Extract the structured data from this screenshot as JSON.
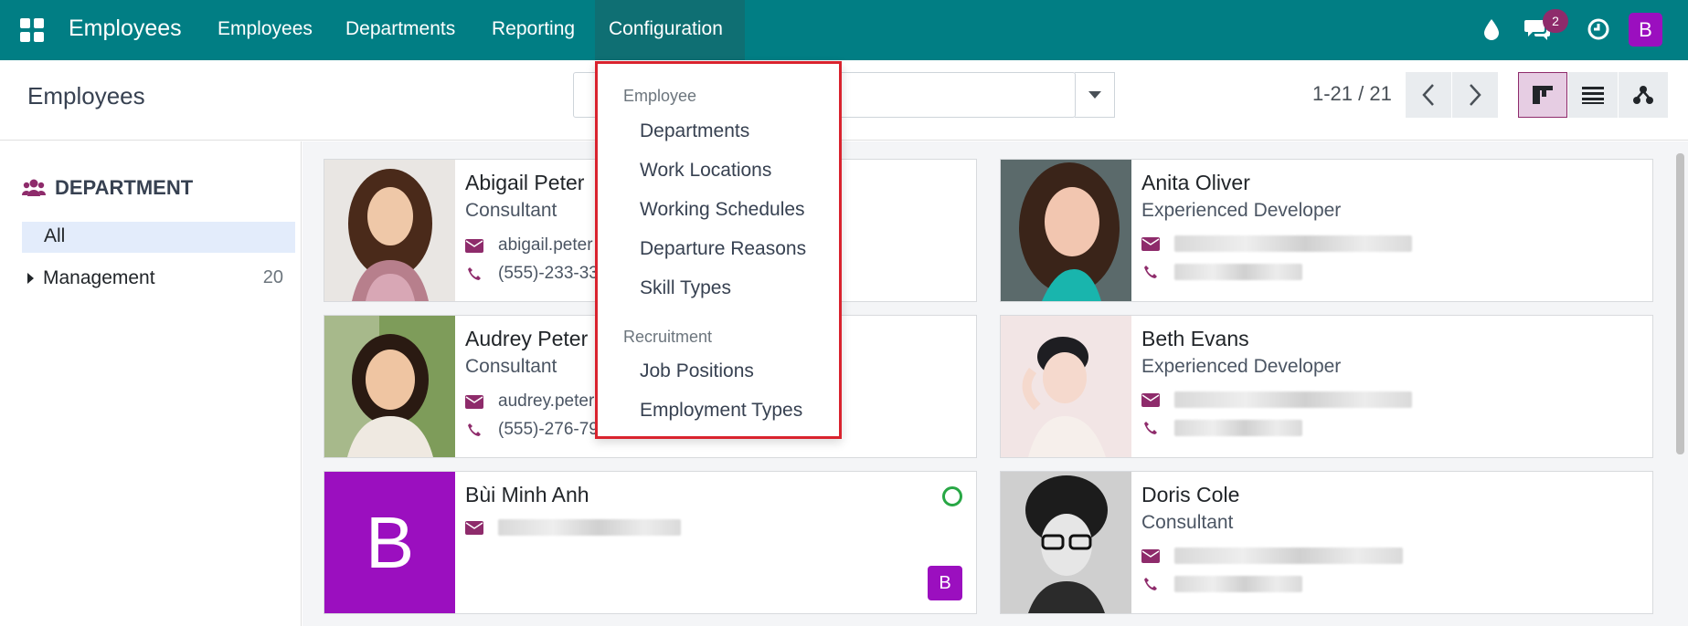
{
  "navbar": {
    "app_name": "Employees",
    "menu": [
      "Employees",
      "Departments",
      "Reporting",
      "Configuration"
    ],
    "message_count": "2",
    "user_initial": "B"
  },
  "control": {
    "page_title": "Employees",
    "pager": "1-21 / 21"
  },
  "sidebar": {
    "header": "DEPARTMENT",
    "all_label": "All",
    "management_label": "Management",
    "management_count": "20"
  },
  "dropdown": {
    "section_employee": "Employee",
    "employee_items": [
      "Departments",
      "Work Locations",
      "Working Schedules",
      "Departure Reasons",
      "Skill Types"
    ],
    "section_recruitment": "Recruitment",
    "recruitment_items": [
      "Job Positions",
      "Employment Types"
    ]
  },
  "employees": [
    {
      "name": "Abigail Peter",
      "job": "Consultant",
      "email": "abigail.peter",
      "phone": "(555)-233-33"
    },
    {
      "name": "Anita Oliver",
      "job": "Experienced Developer"
    },
    {
      "name": "Audrey Peter",
      "job": "Consultant",
      "email": "audrey.peter",
      "phone": "(555)-276-79"
    },
    {
      "name": "Beth Evans",
      "job": "Experienced Developer"
    },
    {
      "name": "Bùi Minh Anh",
      "initial": "B",
      "badge": "B"
    },
    {
      "name": "Doris Cole",
      "job": "Consultant"
    }
  ],
  "colors": {
    "navbar": "#017e84",
    "accent": "#8e2b6b",
    "avatar": "#9b0fbf",
    "highlight_border": "#d9232e"
  }
}
